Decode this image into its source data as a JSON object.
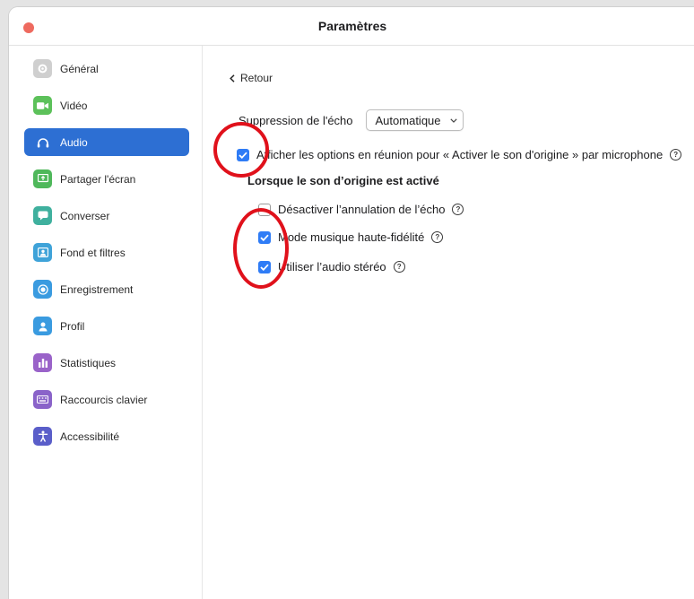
{
  "window": {
    "title": "Paramètres"
  },
  "sidebar": {
    "items": [
      {
        "label": "Général",
        "icon": "gear-icon",
        "color": "#c9c9c9"
      },
      {
        "label": "Vidéo",
        "icon": "video-camera-icon",
        "color": "#5cc15a"
      },
      {
        "label": "Audio",
        "icon": "headphones-icon",
        "color": "#2d6fd3",
        "active": true
      },
      {
        "label": "Partager l'écran",
        "icon": "share-screen-icon",
        "color": "#4fb85b"
      },
      {
        "label": "Converser",
        "icon": "chat-bubble-icon",
        "color": "#3fb09e"
      },
      {
        "label": "Fond et filtres",
        "icon": "background-icon",
        "color": "#3fa3d9"
      },
      {
        "label": "Enregistrement",
        "icon": "record-icon",
        "color": "#3a9be0"
      },
      {
        "label": "Profil",
        "icon": "profile-icon",
        "color": "#3a9be0"
      },
      {
        "label": "Statistiques",
        "icon": "statistics-icon",
        "color": "#9a63c9"
      },
      {
        "label": "Raccourcis clavier",
        "icon": "keyboard-icon",
        "color": "#8a63c9"
      },
      {
        "label": "Accessibilité",
        "icon": "accessibility-icon",
        "color": "#5a5ec9"
      }
    ]
  },
  "content": {
    "back_label": "Retour",
    "echo": {
      "label": "Suppression de l'écho",
      "selected": "Automatique"
    },
    "original_sound": {
      "label": "Afficher les options en réunion pour « Activer le son d'origine » par microphone",
      "checked": true
    },
    "subheading": "Lorsque le son d’origine est activé",
    "options": [
      {
        "label": "Désactiver l’annulation de l’écho",
        "checked": false
      },
      {
        "label": "Mode musique haute-fidélité",
        "checked": true
      },
      {
        "label": "Utiliser l’audio stéréo",
        "checked": true
      }
    ],
    "help_glyph": "?"
  },
  "colors": {
    "accent": "#2d6fd3",
    "checkbox": "#2f7cf6",
    "annotation": "#e0111b"
  }
}
